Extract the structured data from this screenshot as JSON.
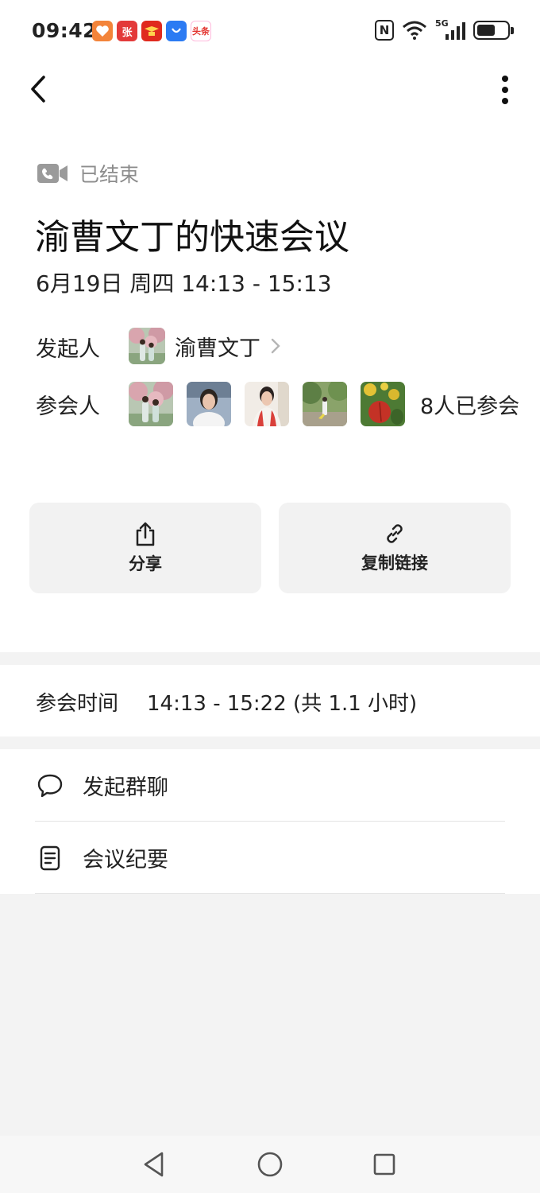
{
  "status_bar": {
    "time": "09:42",
    "apps": [
      {
        "icon": "heart-app-icon",
        "glyph": "♥",
        "color": "#f3843a"
      },
      {
        "icon": "zhang-app-icon",
        "glyph": "张",
        "color": "#e33a3a"
      },
      {
        "icon": "learning-app-icon",
        "glyph": "学",
        "color": "#e02a1e"
      },
      {
        "icon": "store-app-icon",
        "glyph": "◆",
        "color": "#2b7bf3"
      },
      {
        "icon": "toutiao-app-icon",
        "glyph": "头条",
        "color": "#e3342f"
      }
    ],
    "network": "5G"
  },
  "meeting": {
    "status": "已结束",
    "title": "渝曹文丁的快速会议",
    "datetime": "6月19日 周四 14:13 - 15:13",
    "host_label": "发起人",
    "host_name": "渝曹文丁",
    "participants_label": "参会人",
    "participants_count": "8人已参会",
    "participants": [
      {
        "name": "participant-1"
      },
      {
        "name": "participant-2"
      },
      {
        "name": "participant-3"
      },
      {
        "name": "participant-4"
      },
      {
        "name": "participant-5"
      }
    ]
  },
  "actions": {
    "share_label": "分享",
    "copy_link_label": "复制链接"
  },
  "attendance": {
    "label": "参会时间",
    "value": "14:13 - 15:22 (共 1.1 小时)"
  },
  "menu": {
    "group_chat_label": "发起群聊",
    "minutes_label": "会议纪要"
  },
  "icons": {
    "back": "back-arrow-icon",
    "more": "more-vertical-icon",
    "video": "video-camera-icon",
    "share": "share-icon",
    "link": "link-icon",
    "chat": "chat-bubble-icon",
    "doc": "document-icon"
  },
  "colors": {
    "muted_text": "#8c8c8c",
    "button_bg": "#f2f2f2",
    "page_bg": "#f3f3f3"
  }
}
